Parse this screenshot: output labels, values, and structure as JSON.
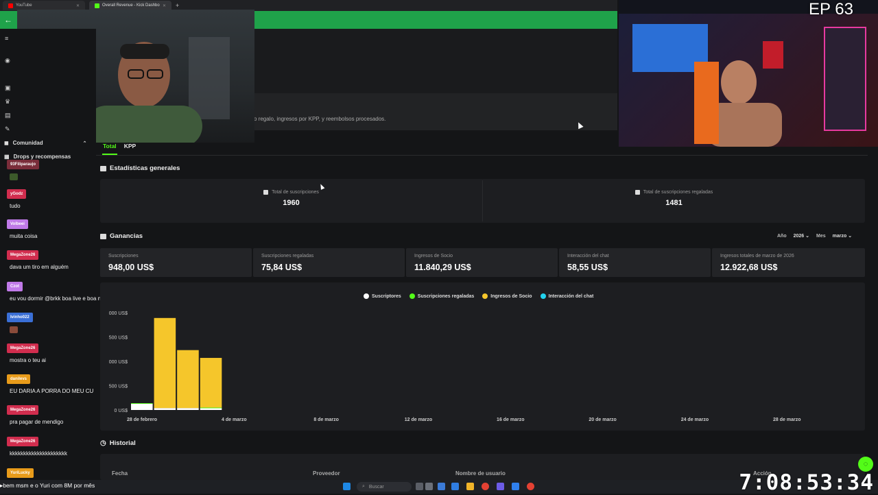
{
  "browser": {
    "tabs": [
      {
        "title": "YouTube",
        "favicon_color": "#ff0000"
      },
      {
        "title": "Overall Revenue - Kick Dashbo",
        "favicon_color": "#53fc18"
      }
    ],
    "new_tab": "+",
    "accent": "#1fa24a"
  },
  "overlay": {
    "episode": "EP 63",
    "timer": "7:08:53:34"
  },
  "page": {
    "description_fragment": "o regalo, ingresos por KPP, y reembolsos procesados."
  },
  "sidebar": {
    "items": [
      {
        "label": "Comunidad",
        "icon": "users-icon"
      },
      {
        "label": "Drops y recompensas",
        "icon": "gift-icon"
      }
    ]
  },
  "chat": [
    {
      "user": "93Filiparaujo",
      "color": "#7a2d3a",
      "text": "",
      "emote": "#3c5a2a"
    },
    {
      "user": "yGodz",
      "color": "#d12d4e",
      "text": "tudo"
    },
    {
      "user": "Volbeei",
      "color": "#c07ae8",
      "text": "muita coisa"
    },
    {
      "user": "MegaZone26",
      "color": "#d12d4e",
      "text": "dava um tiro em alguém"
    },
    {
      "user": "Czot",
      "color": "#c07ae8",
      "text": "eu vou dormir @brkk boa live e boa noite chat"
    },
    {
      "user": "Ivinho022",
      "color": "#3a6fd6",
      "text": "",
      "emote": "#8a4b3a"
    },
    {
      "user": "MegaZone26",
      "color": "#d12d4e",
      "text": "mostra o teu ai"
    },
    {
      "user": "danilevs",
      "color": "#e89b1a",
      "text": "EU DARIA A PORRA DO MEU CU"
    },
    {
      "user": "MegaZone26",
      "color": "#d12d4e",
      "text": "pra pagar de mendigo"
    },
    {
      "user": "MegaZone26",
      "color": "#d12d4e",
      "text": "kkkkkkkkkkkkkkkkkkkkk"
    },
    {
      "user": "YuriLucky",
      "color": "#e89b1a",
      "text": "bem msm e o Yuri com 8M por mês"
    }
  ],
  "tabs": {
    "total": "Total",
    "kpp": "KPP"
  },
  "estadisticas": {
    "title": "Estadísticas generales",
    "total_subs_label": "Total de suscripciones",
    "total_subs_value": "1960",
    "gifted_subs_label": "Total de suscripciones regaladas",
    "gifted_subs_value": "1481"
  },
  "ganancias": {
    "title": "Ganancias",
    "year_label": "Año",
    "year_value": "2026",
    "month_label": "Mes",
    "month_value": "marzo",
    "cells": [
      {
        "label": "Suscripciones",
        "value": "948,00 US$"
      },
      {
        "label": "Suscripciones regaladas",
        "value": "75,84 US$"
      },
      {
        "label": "Ingresos de Socio",
        "value": "11.840,29 US$"
      },
      {
        "label": "Interacción del chat",
        "value": "58,55 US$"
      },
      {
        "label": "Ingresos totales de marzo de 2026",
        "value": "12.922,68 US$"
      }
    ]
  },
  "chart_data": {
    "type": "bar",
    "stacked": true,
    "legend": [
      "Suscriptores",
      "Suscripciones regaladas",
      "Ingresos de Socio",
      "Interacción del chat"
    ],
    "legend_placement": "top-center",
    "colors": {
      "Suscriptores": "#ffffff",
      "Suscripciones regaladas": "#53fc18",
      "Ingresos de Socio": "#f5c62b",
      "Interacción del chat": "#22d3ee"
    },
    "y_ticks": [
      "0 US$",
      "500 US$",
      "000 US$",
      "500 US$",
      "000 US$"
    ],
    "y_tick_values": [
      0,
      500,
      1000,
      1500,
      2000
    ],
    "ylim": [
      0,
      2000
    ],
    "x_ticks": [
      "28 de febrero",
      "4 de marzo",
      "8 de marzo",
      "12 de marzo",
      "16 de marzo",
      "20 de marzo",
      "24 de marzo",
      "28 de marzo"
    ],
    "bars": [
      {
        "day": 1,
        "Suscriptores": 130,
        "Suscripciones regaladas": 10,
        "Ingresos de Socio": 0,
        "Interacción del chat": 0
      },
      {
        "day": 2,
        "Suscriptores": 40,
        "Suscripciones regaladas": 0,
        "Ingresos de Socio": 1850,
        "Interacción del chat": 0
      },
      {
        "day": 3,
        "Suscriptores": 40,
        "Suscripciones regaladas": 0,
        "Ingresos de Socio": 1190,
        "Interacción del chat": 0
      },
      {
        "day": 4,
        "Suscriptores": 40,
        "Suscripciones regaladas": 10,
        "Ingresos de Socio": 1020,
        "Interacción del chat": 0
      }
    ]
  },
  "historial": {
    "title": "Historial",
    "columns": [
      "Fecha",
      "Proveedor",
      "Nombre de usuario",
      "Acción"
    ]
  },
  "taskbar": {
    "search": "Buscar"
  }
}
